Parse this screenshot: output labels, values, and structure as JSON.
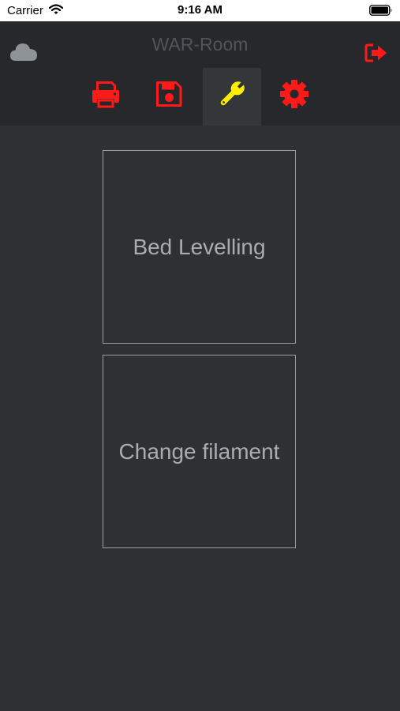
{
  "status_bar": {
    "carrier": "Carrier",
    "time": "9:16 AM"
  },
  "header": {
    "title": "WAR-Room",
    "cloud_icon": "cloud-icon",
    "logout_icon": "sign-out-icon"
  },
  "tabs": [
    {
      "name": "print",
      "icon": "printer-icon",
      "active": false
    },
    {
      "name": "files",
      "icon": "floppy-disk-icon",
      "active": false
    },
    {
      "name": "tools",
      "icon": "wrench-icon",
      "active": true
    },
    {
      "name": "settings",
      "icon": "gear-icon",
      "active": false
    }
  ],
  "tools": {
    "bed_levelling": "Bed Levelling",
    "change_filament": "Change filament"
  },
  "colors": {
    "accent": "#ff1a1a",
    "active": "#ffee00",
    "background": "#2e3134",
    "header_background": "#26282b",
    "text": "#a9adb1"
  }
}
